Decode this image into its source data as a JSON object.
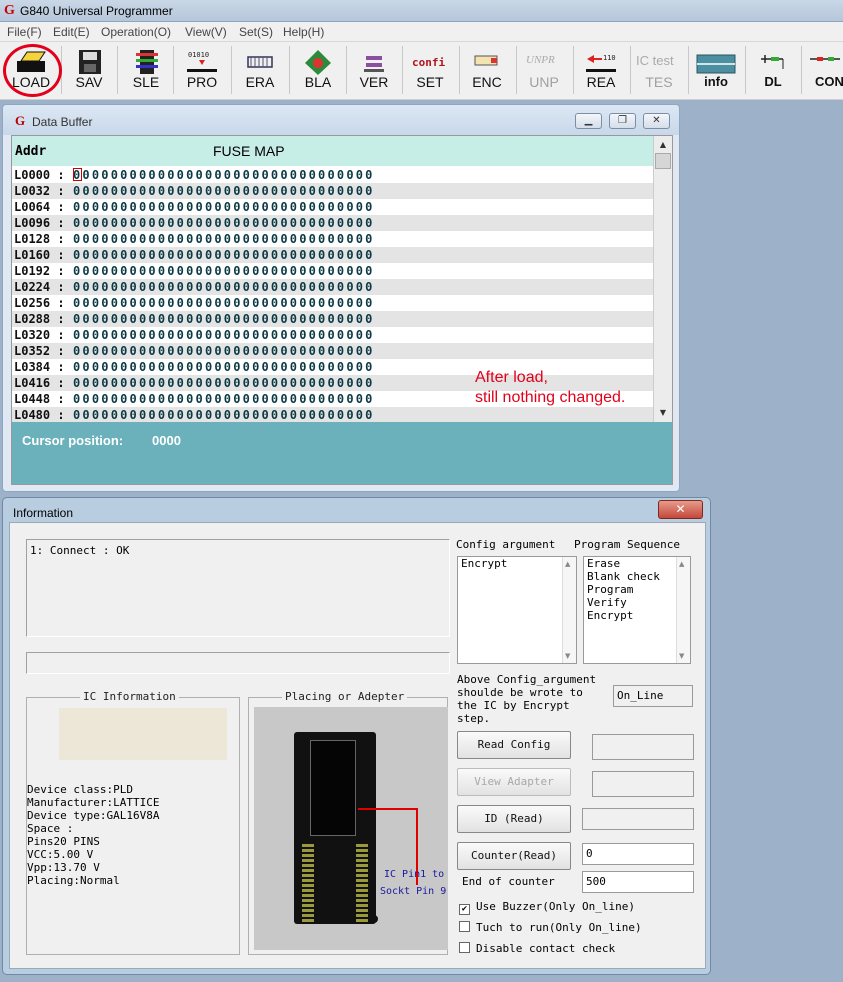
{
  "app": {
    "title": "G840 Universal Programmer",
    "logo": "G"
  },
  "menu": [
    "File(F)",
    "Edit(E)",
    "Operation(O)",
    "View(V)",
    "Set(S)",
    "Help(H)"
  ],
  "toolbar": [
    {
      "label": "LOAD",
      "icon": "load-icon",
      "enabled": true
    },
    {
      "label": "SAV",
      "icon": "save-icon",
      "enabled": true
    },
    {
      "label": "SLE",
      "icon": "select-chip-icon",
      "enabled": true
    },
    {
      "label": "PRO",
      "icon": "program-icon",
      "enabled": true
    },
    {
      "label": "ERA",
      "icon": "erase-icon",
      "enabled": true
    },
    {
      "label": "BLA",
      "icon": "blank-check-icon",
      "enabled": true
    },
    {
      "label": "VER",
      "icon": "verify-icon",
      "enabled": true
    },
    {
      "label": "SET",
      "icon": "config-icon",
      "enabled": true,
      "icon_text": "confi"
    },
    {
      "label": "ENC",
      "icon": "encrypt-icon",
      "enabled": true
    },
    {
      "label": "UNP",
      "icon": "unprotect-icon",
      "enabled": false,
      "icon_text": "UNPR"
    },
    {
      "label": "REA",
      "icon": "read-icon",
      "enabled": true
    },
    {
      "label": "TES",
      "icon": "ic-test-icon",
      "enabled": false,
      "icon_text": "IC test"
    },
    {
      "label": "info",
      "icon": "info-icon",
      "enabled": true
    },
    {
      "label": "DL",
      "icon": "download-icon",
      "enabled": true
    },
    {
      "label": "CON",
      "icon": "connect-icon",
      "enabled": true
    }
  ],
  "data_buffer": {
    "logo": "G",
    "title": "Data Buffer",
    "addr_header": "Addr",
    "map_header": "FUSE MAP",
    "rows": [
      {
        "addr": "L0000 :",
        "bits": "00000000000000000000000000000000"
      },
      {
        "addr": "L0032 :",
        "bits": "00000000000000000000000000000000"
      },
      {
        "addr": "L0064 :",
        "bits": "00000000000000000000000000000000"
      },
      {
        "addr": "L0096 :",
        "bits": "00000000000000000000000000000000"
      },
      {
        "addr": "L0128 :",
        "bits": "00000000000000000000000000000000"
      },
      {
        "addr": "L0160 :",
        "bits": "00000000000000000000000000000000"
      },
      {
        "addr": "L0192 :",
        "bits": "00000000000000000000000000000000"
      },
      {
        "addr": "L0224 :",
        "bits": "00000000000000000000000000000000"
      },
      {
        "addr": "L0256 :",
        "bits": "00000000000000000000000000000000"
      },
      {
        "addr": "L0288 :",
        "bits": "00000000000000000000000000000000"
      },
      {
        "addr": "L0320 :",
        "bits": "00000000000000000000000000000000"
      },
      {
        "addr": "L0352 :",
        "bits": "00000000000000000000000000000000"
      },
      {
        "addr": "L0384 :",
        "bits": "00000000000000000000000000000000"
      },
      {
        "addr": "L0416 :",
        "bits": "00000000000000000000000000000000"
      },
      {
        "addr": "L0448 :",
        "bits": "00000000000000000000000000000000"
      },
      {
        "addr": "L0480 :",
        "bits": "00000000000000000000000000000000"
      }
    ],
    "annotation_line1": "After load,",
    "annotation_line2": "still nothing changed.",
    "cursor_label": "Cursor position:",
    "cursor_value": "0000"
  },
  "information": {
    "title": "Information",
    "close": "✕",
    "log": "1: Connect :  OK",
    "ic_info_label": "IC Information",
    "ic_info_lines": [
      "Device class:PLD",
      "Manufacturer:LATTICE",
      "Device type:GAL16V8A",
      "Space :",
      "Pins20    PINS",
      "VCC:5.00   V",
      "Vpp:13.70   V",
      "Placing:Normal"
    ],
    "placing_label": "Placing or Adepter",
    "ic_pin_label": "IC Pin1 to",
    "sockt_pin_label": "Sockt Pin 9",
    "config_argument_label": "Config argument",
    "config_items": [
      "Encrypt"
    ],
    "program_sequence_label": "Program Sequence",
    "sequence_items": [
      "Erase",
      "Blank check",
      "Program",
      "Verify",
      "Encrypt"
    ],
    "note": "Above Config_argument shoulde be wrote to the IC by Encrypt step.",
    "mode": "On_Line",
    "read_config": "Read Config",
    "view_adapter": "View Adapter",
    "id_read": "ID (Read)",
    "counter_read": "Counter(Read)",
    "counter_value": "0",
    "end_counter_label": "End of counter",
    "end_counter_value": "500",
    "use_buzzer": "Use Buzzer(Only On_line)",
    "use_buzzer_checked": true,
    "tuch_to_run": "Tuch to run(Only On_line)",
    "tuch_to_run_checked": false,
    "disable_contact": "Disable contact check",
    "disable_contact_checked": false
  }
}
